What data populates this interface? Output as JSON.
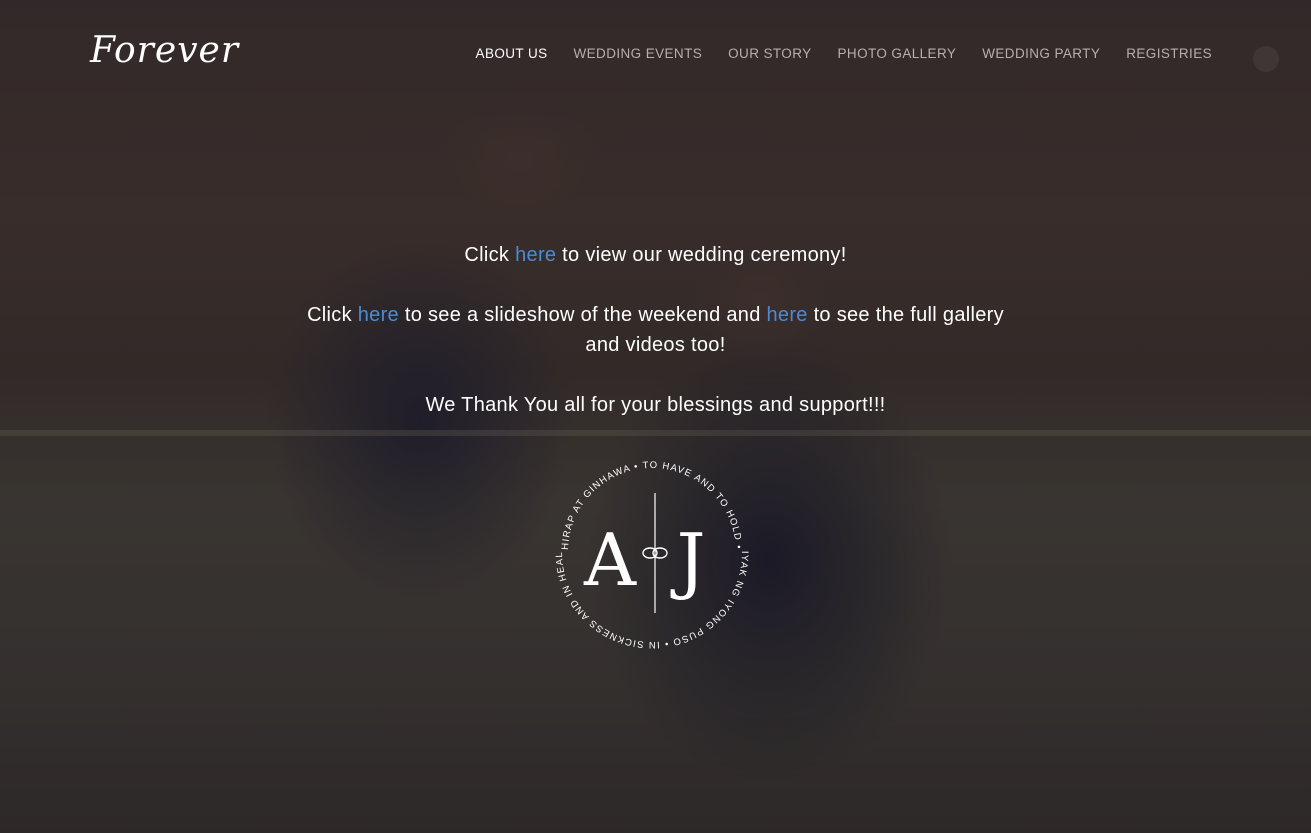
{
  "header": {
    "logo_text": "Forever",
    "nav": [
      {
        "label": "ABOUT US",
        "active": true
      },
      {
        "label": "WEDDING EVENTS"
      },
      {
        "label": "OUR STORY"
      },
      {
        "label": "PHOTO GALLERY"
      },
      {
        "label": "WEDDING PARTY"
      },
      {
        "label": "REGISTRIES"
      }
    ]
  },
  "main": {
    "line1": {
      "before": "Click ",
      "link": "here",
      "after": " to view our wedding ceremony!"
    },
    "line2": {
      "before": "Click ",
      "link1": "here",
      "middle": " to see a slideshow of the weekend and ",
      "link2": "here",
      "after": " to see the full gallery and videos too!"
    },
    "line3": "We Thank You all for your blessings and support!!!"
  },
  "monogram": {
    "letter_left": "A",
    "letter_right": "J",
    "ring_top": "HIRAP AT GINHAWA • TO HAVE AND TO HOLD •",
    "ring_bottom": "KABIYAK NG IYONG PUSO • IN SICKNESS AND IN HEALTH •"
  },
  "colors": {
    "link": "#4a8cd4",
    "text": "#ffffff",
    "nav_inactive": "#b6b0ac"
  }
}
